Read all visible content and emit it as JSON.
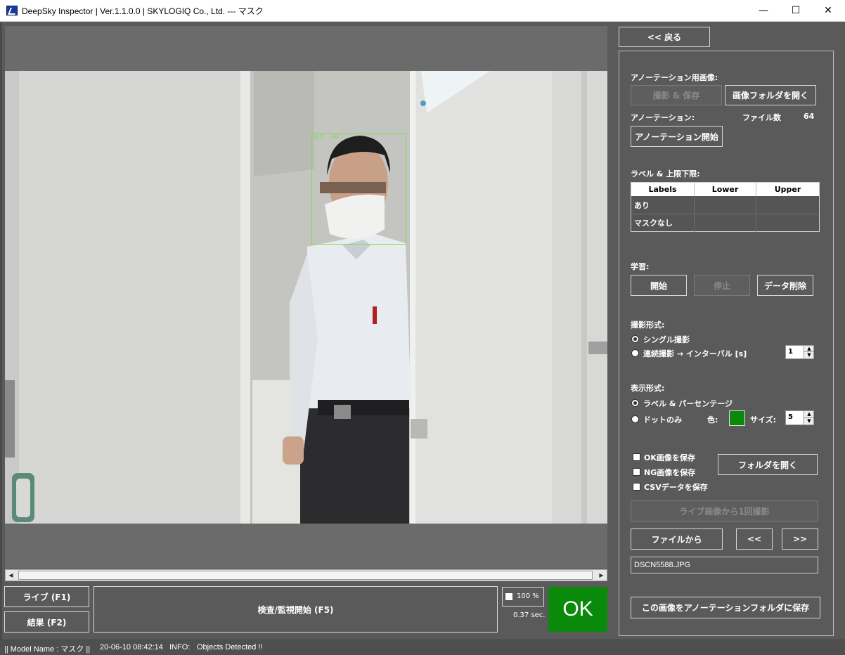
{
  "window": {
    "title": "DeepSky Inspector | Ver.1.1.0.0 | SKYLOGIQ Co., Ltd. --- マスク",
    "minimize": "—",
    "maximize": "☐",
    "close": "✕"
  },
  "viewer": {
    "detection_label": "あり .99",
    "scroll_left": "◀",
    "scroll_right": "▶"
  },
  "bottom": {
    "live_button": "ライブ (F1)",
    "result_button": "結果 (F2)",
    "inspect_button": "検査/監視開始 (F5)",
    "zoom_value": "100 %",
    "elapsed": "0.37 sec.",
    "verdict": "OK",
    "verdict_color": "#0a8a0a"
  },
  "status": {
    "model": "|| Model Name : マスク ||",
    "timestamp": "20-06-10 08:42:14",
    "info_label": "INFO:",
    "info_message": "Objects Detected !!"
  },
  "panel": {
    "back_button": "<< 戻る",
    "annotation_image_label": "アノーテーション用画像:",
    "capture_save_button": "撮影 & 保存",
    "open_image_folder_button": "画像フォルダを開く",
    "annotation_label": "アノーテーション:",
    "file_count_label": "ファイル数",
    "file_count_value": "64",
    "start_annotation_button": "アノーテーション開始",
    "labels_section": "ラベル & 上限下限:",
    "table": {
      "headers": [
        "Labels",
        "Lower",
        "Upper"
      ],
      "rows": [
        [
          "あり",
          "",
          ""
        ],
        [
          "マスクなし",
          "",
          ""
        ]
      ]
    },
    "learning_label": "学習:",
    "learn_start_button": "開始",
    "learn_stop_button": "停止",
    "delete_data_button": "データ削除",
    "capture_mode_label": "撮影形式:",
    "single_capture": "シングル撮影",
    "continuous_capture": "連続撮影 → インターバル [s]",
    "interval_value": "1",
    "display_mode_label": "表示形式:",
    "label_percentage": "ラベル & パーセンテージ",
    "dots_only": "ドットのみ",
    "color_label": "色:",
    "dot_color": "#0a8a0a",
    "size_label": "サイズ:",
    "size_value": "5",
    "save_ok_images": "OK画像を保存",
    "save_ng_images": "NG画像を保存",
    "save_csv": "CSVデータを保存",
    "open_folder_button": "フォルダを開く",
    "capture_once_button": "ライブ画像から1回撮影",
    "from_file_button": "ファイルから",
    "prev_button": "<<",
    "next_button": ">>",
    "filename": "DSCN5588.JPG",
    "save_to_annotation_button": "この画像をアノーテーションフォルダに保存"
  }
}
